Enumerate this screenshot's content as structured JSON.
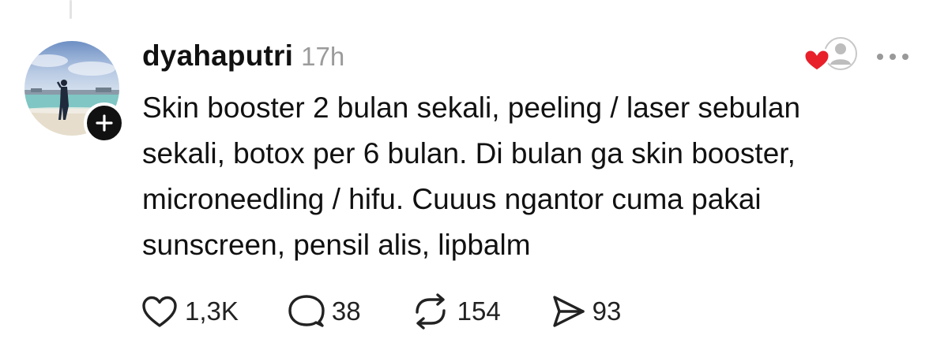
{
  "post": {
    "username": "dyahaputri",
    "timestamp": "17h",
    "text": "Skin booster 2 bulan sekali, peeling / laser sebulan\nsekali, botox per 6 bulan. Di bulan ga skin booster,\nmicroneedling / hifu. Cuuus ngantor cuma pakai\nsunscreen, pensil alis, lipbalm",
    "stats": {
      "likes": "1,3K",
      "replies": "38",
      "reposts": "154",
      "shares": "93"
    }
  },
  "icons": {
    "follow": "plus-icon",
    "liked_by": "liked-by-avatar-heart-icon",
    "more": "more-horizontal-icon",
    "like": "heart-icon",
    "reply": "comment-bubble-icon",
    "repost": "repost-icon",
    "share": "send-icon"
  },
  "colors": {
    "text": "#111111",
    "muted": "#9b9b9b",
    "heart_accent": "#e8202a",
    "follow_button": "#111111"
  }
}
